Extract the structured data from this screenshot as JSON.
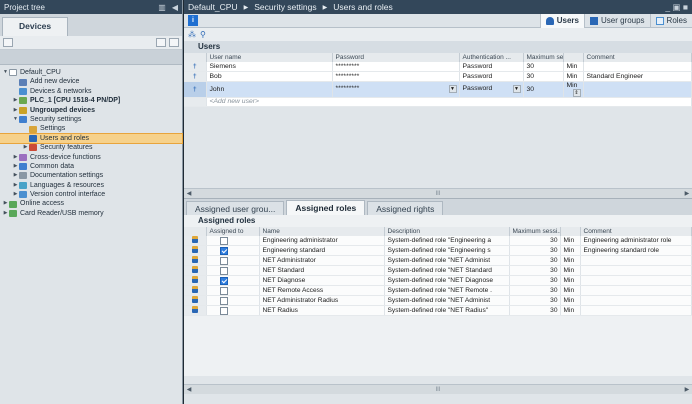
{
  "tree": {
    "title": "Project tree",
    "tab": "Devices",
    "items": [
      {
        "label": "Default_CPU",
        "level": 0,
        "arrow": "▼",
        "color": "#ffffff",
        "bold": false,
        "selected": false
      },
      {
        "label": "Add new device",
        "level": 1,
        "arrow": "",
        "color": "#5b7fb6",
        "bold": false,
        "selected": false
      },
      {
        "label": "Devices & networks",
        "level": 1,
        "arrow": "",
        "color": "#4a8fd0",
        "bold": false,
        "selected": false
      },
      {
        "label": "PLC_1 [CPU 1518-4 PN/DP]",
        "level": 1,
        "arrow": "▶",
        "color": "#6aa84f",
        "bold": true,
        "selected": false
      },
      {
        "label": "Ungrouped devices",
        "level": 1,
        "arrow": "▶",
        "color": "#c9a227",
        "bold": true,
        "selected": false
      },
      {
        "label": "Security settings",
        "level": 1,
        "arrow": "▼",
        "color": "#3f7fcf",
        "bold": false,
        "selected": false
      },
      {
        "label": "Settings",
        "level": 2,
        "arrow": "",
        "color": "#d9a53a",
        "bold": false,
        "selected": false
      },
      {
        "label": "Users and roles",
        "level": 2,
        "arrow": "",
        "color": "#2a67b5",
        "bold": false,
        "selected": true
      },
      {
        "label": "Security features",
        "level": 2,
        "arrow": "▶",
        "color": "#cc4b37",
        "bold": false,
        "selected": false
      },
      {
        "label": "Cross-device functions",
        "level": 1,
        "arrow": "▶",
        "color": "#9b6fc0",
        "bold": false,
        "selected": false
      },
      {
        "label": "Common data",
        "level": 1,
        "arrow": "▶",
        "color": "#3f7fcf",
        "bold": false,
        "selected": false
      },
      {
        "label": "Documentation settings",
        "level": 1,
        "arrow": "▶",
        "color": "#8a98a5",
        "bold": false,
        "selected": false
      },
      {
        "label": "Languages & resources",
        "level": 1,
        "arrow": "▶",
        "color": "#4aa3c8",
        "bold": false,
        "selected": false
      },
      {
        "label": "Version control interface",
        "level": 1,
        "arrow": "▶",
        "color": "#4a8fd0",
        "bold": false,
        "selected": false
      },
      {
        "label": "Online access",
        "level": 0,
        "arrow": "▶",
        "color": "#5aa85a",
        "bold": false,
        "selected": false
      },
      {
        "label": "Card Reader/USB memory",
        "level": 0,
        "arrow": "▶",
        "color": "#5aa85a",
        "bold": false,
        "selected": false
      }
    ]
  },
  "breadcrumb": [
    "Default_CPU",
    "Security settings",
    "Users and roles"
  ],
  "editor_tabs": [
    {
      "label": "Users",
      "active": true,
      "color": "#2a67b5"
    },
    {
      "label": "User groups",
      "active": false,
      "color": "#2a67b5"
    },
    {
      "label": "Roles",
      "active": false,
      "color": "#4a8fd0"
    }
  ],
  "users": {
    "header": "Users",
    "columns": [
      "User name",
      "Password",
      "Authentication ...",
      "Maximum sessi...",
      "",
      "Comment"
    ],
    "rows": [
      {
        "name": "Siemens",
        "password": "*********",
        "auth": "Password",
        "max": "30",
        "unit": "Min",
        "comment": "",
        "selected": false
      },
      {
        "name": "Bob",
        "password": "*********",
        "auth": "Password",
        "max": "30",
        "unit": "Min",
        "comment": "Standard Engineer",
        "selected": false
      },
      {
        "name": "John",
        "password": "*********",
        "auth": "Password",
        "max": "30",
        "unit": "Min",
        "comment": "",
        "selected": true
      }
    ],
    "add_placeholder": "<Add new user>"
  },
  "bottom_tabs": [
    {
      "label": "Assigned user grou...",
      "active": false
    },
    {
      "label": "Assigned roles",
      "active": true
    },
    {
      "label": "Assigned rights",
      "active": false
    }
  ],
  "roles": {
    "header": "Assigned roles",
    "columns": [
      "Assigned to",
      "Name",
      "Description",
      "Maximum sessi...",
      "Comment"
    ],
    "rows": [
      {
        "assigned": false,
        "name": "Engineering administrator",
        "desc": "System-defined role \"Engineering a",
        "max": "30",
        "unit": "Min",
        "comment": "Engineering administrator role"
      },
      {
        "assigned": true,
        "name": "Engineering standard",
        "desc": "System-defined role \"Engineering s",
        "max": "30",
        "unit": "Min",
        "comment": "Engineering standard role"
      },
      {
        "assigned": false,
        "name": "NET Administrator",
        "desc": "System-defined role \"NET Administ",
        "max": "30",
        "unit": "Min",
        "comment": ""
      },
      {
        "assigned": false,
        "name": "NET Standard",
        "desc": "System-defined role \"NET Standard",
        "max": "30",
        "unit": "Min",
        "comment": ""
      },
      {
        "assigned": true,
        "name": "NET Diagnose",
        "desc": "System-defined role \"NET Diagnose",
        "max": "30",
        "unit": "Min",
        "comment": ""
      },
      {
        "assigned": false,
        "name": "NET Remote Access",
        "desc": "System-defined role \"NET Remote .",
        "max": "30",
        "unit": "Min",
        "comment": ""
      },
      {
        "assigned": false,
        "name": "NET Administrator Radius",
        "desc": "System-defined role \"NET Administ",
        "max": "30",
        "unit": "Min",
        "comment": ""
      },
      {
        "assigned": false,
        "name": "NET Radius",
        "desc": "System-defined role \"NET Radius\"",
        "max": "30",
        "unit": "Min",
        "comment": ""
      }
    ]
  }
}
